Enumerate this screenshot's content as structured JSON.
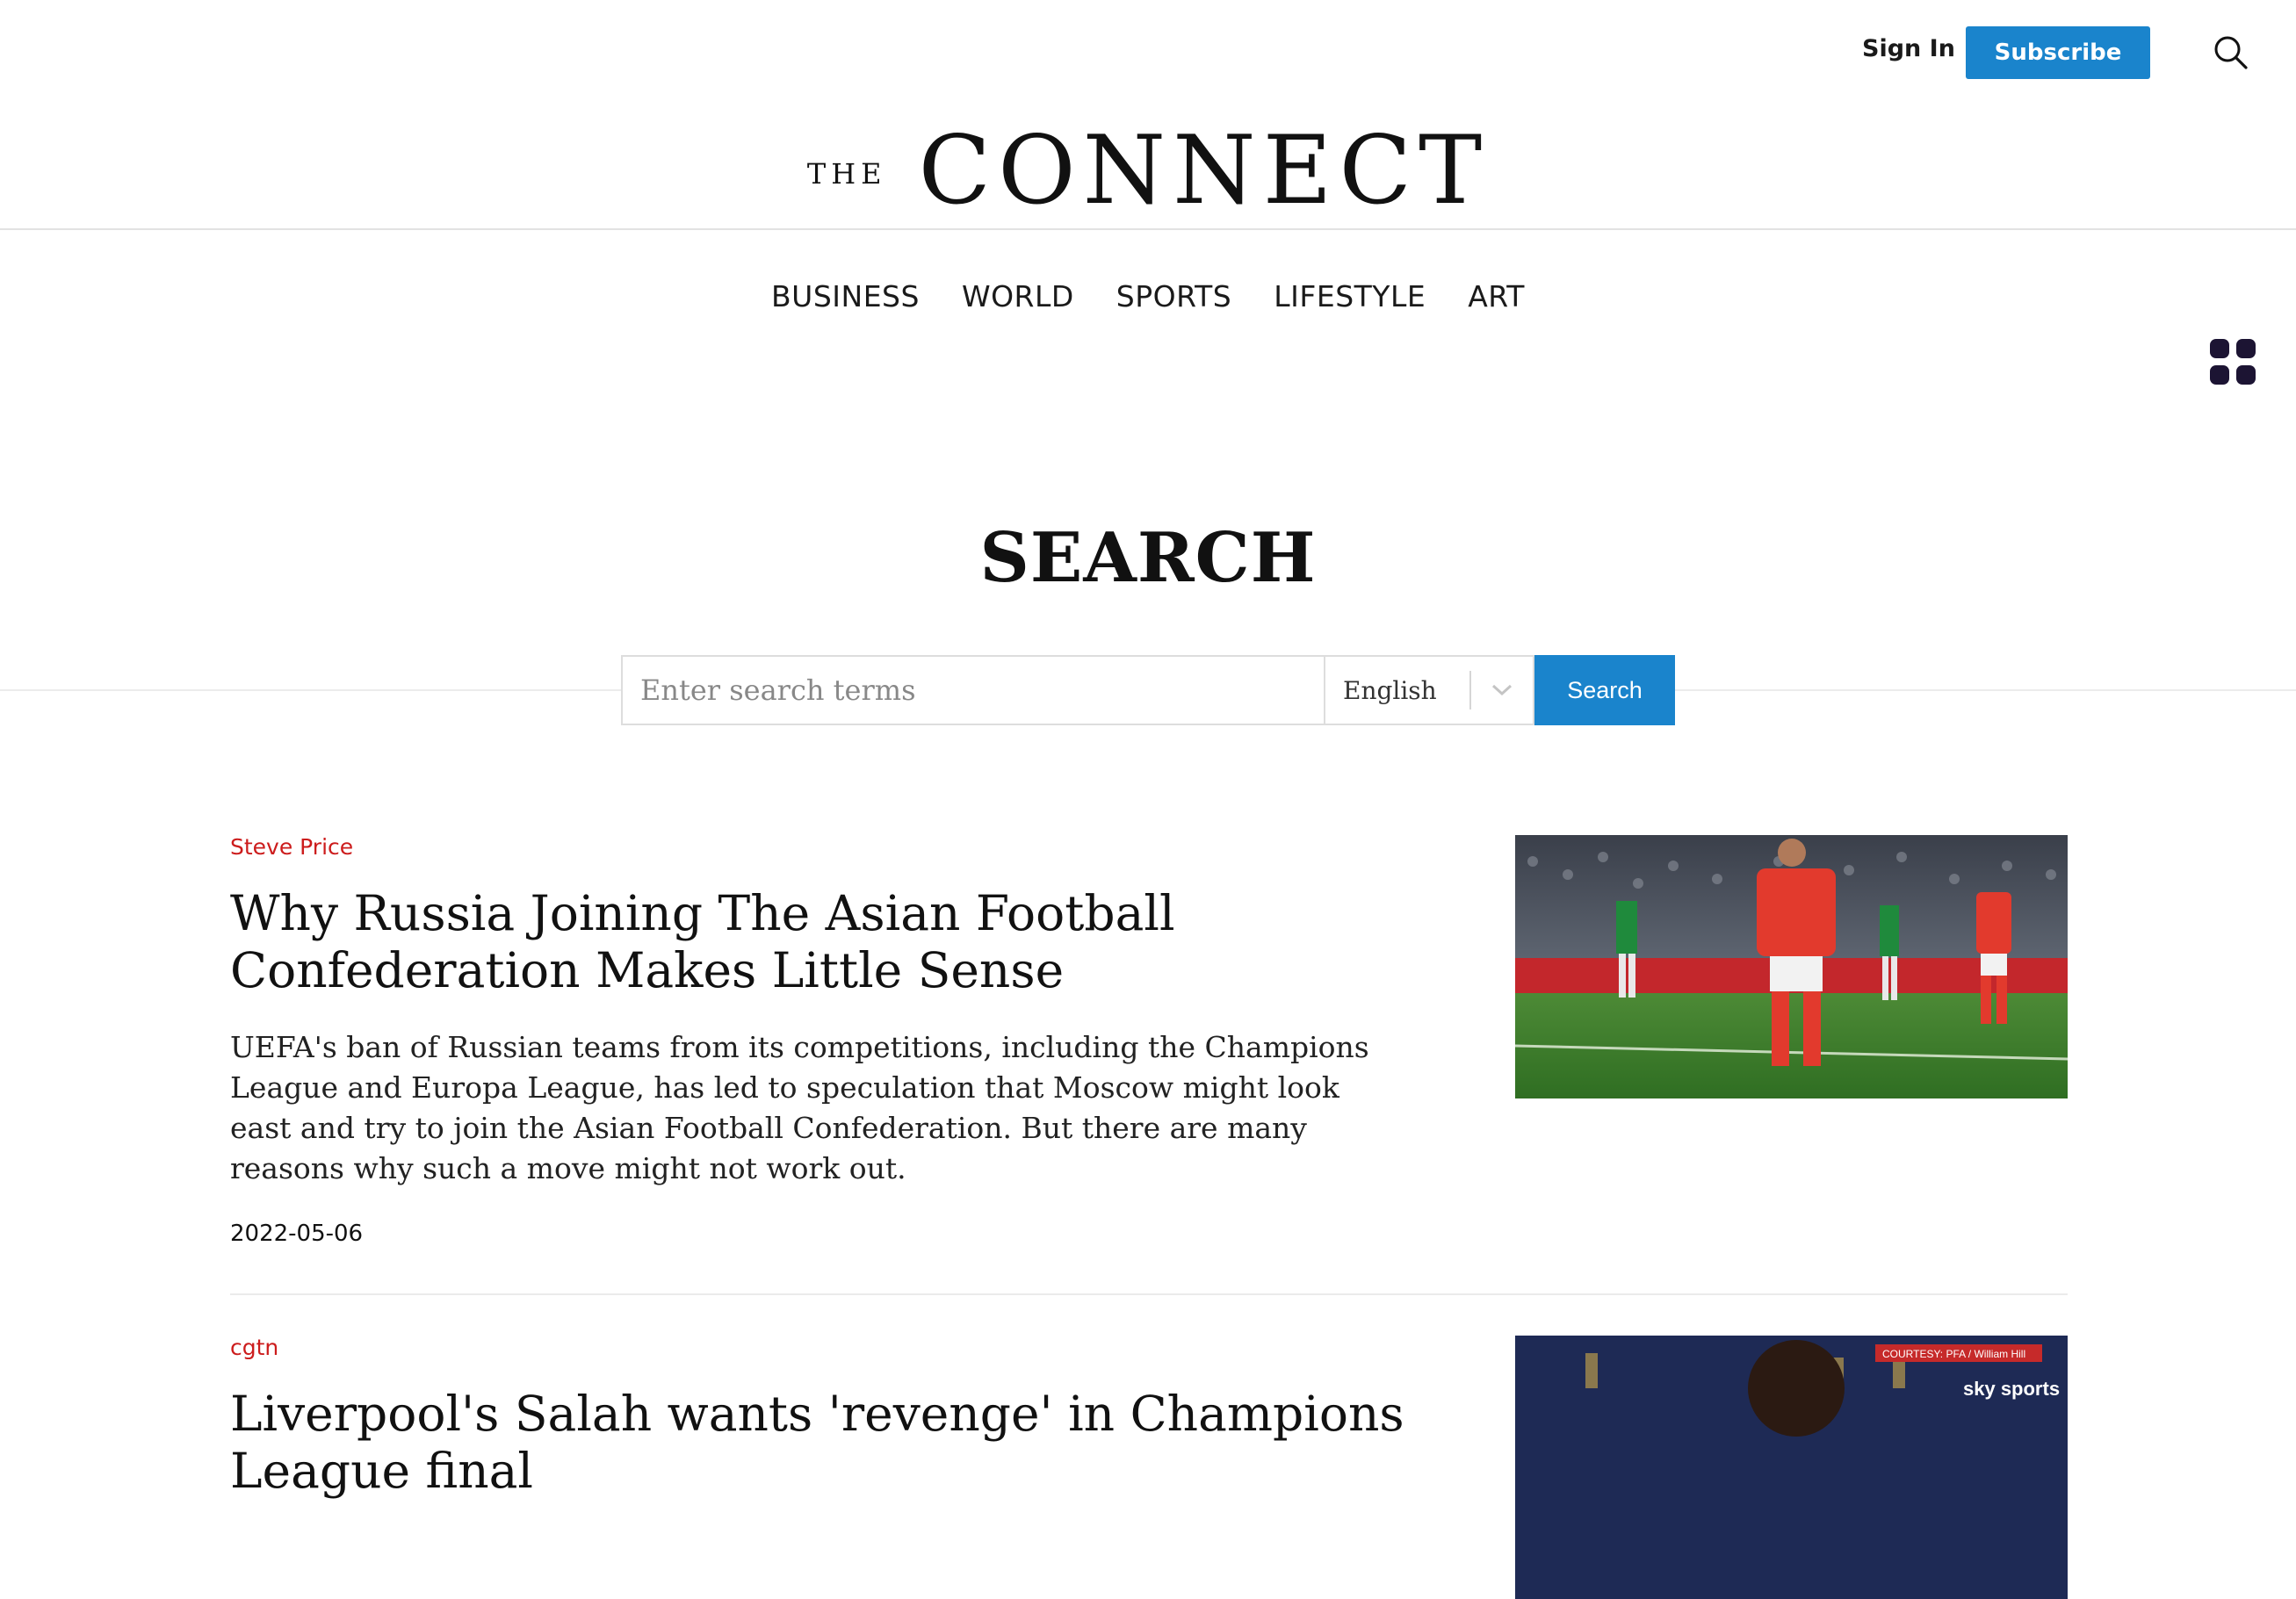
{
  "header": {
    "signin_label": "Sign In",
    "subscribe_label": "Subscribe",
    "search_icon": "search-icon"
  },
  "logo": {
    "the": "THE",
    "name": "CONNECT"
  },
  "nav": {
    "items": [
      "BUSINESS",
      "WORLD",
      "SPORTS",
      "LIFESTYLE",
      "ART"
    ],
    "menu_icon": "grid-menu-icon"
  },
  "search": {
    "title": "SEARCH",
    "placeholder": "Enter search terms",
    "value": "",
    "language": "English",
    "button_label": "Search"
  },
  "results": [
    {
      "author": "Steve Price",
      "title": "Why Russia Joining The Asian Football Confederation Makes Little Sense",
      "summary": "UEFA's ban of Russian teams from its competitions, including the Champions League and Europa League, has led to speculation that Moscow might look east and try to join the Asian Football Confederation. But there are many reasons why such a move might not work out.",
      "date": "2022-05-06"
    },
    {
      "author": "cgtn",
      "title": "Liverpool's Salah wants 'revenge' in Champions League final",
      "summary": "",
      "date": "",
      "image_caption": "COURTESY: PFA / William Hill",
      "image_brand": "sky sports"
    }
  ],
  "colors": {
    "accent_blue": "#1a84cc",
    "author_red": "#cc1c1c",
    "text_dark": "#111111"
  }
}
